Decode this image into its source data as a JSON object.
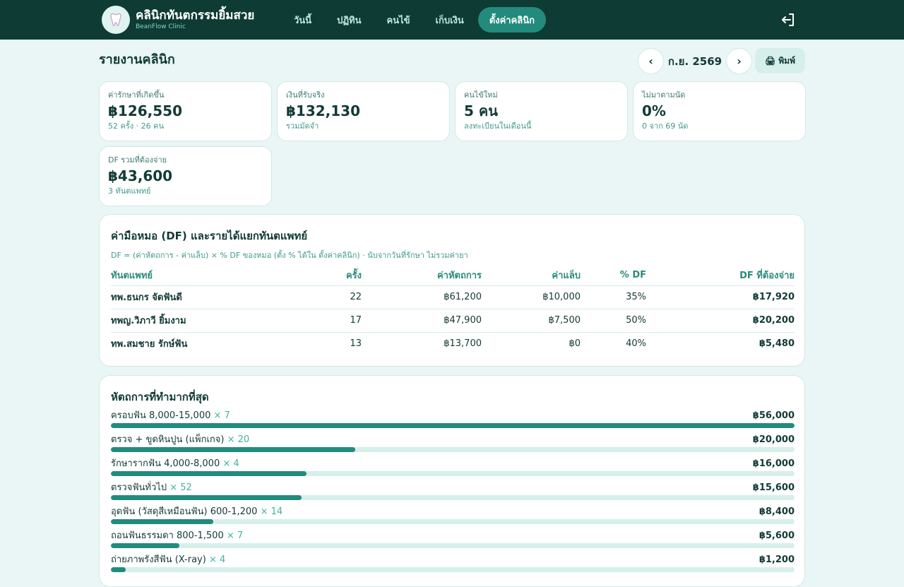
{
  "header": {
    "clinic_name": "คลินิกทันตกรรมยิ้มสวย",
    "clinic_sub": "BeanFlow Clinic",
    "nav": [
      {
        "label": "วันนี้",
        "active": false
      },
      {
        "label": "ปฏิทิน",
        "active": false
      },
      {
        "label": "คนไข้",
        "active": false
      },
      {
        "label": "เก็บเงิน",
        "active": false
      },
      {
        "label": "ตั้งค่าคลินิก",
        "active": true
      }
    ],
    "logout_icon": "logout-icon"
  },
  "report": {
    "title": "รายงานคลินิก",
    "month": "ก.ย. 2569",
    "prev": "‹",
    "next": "›",
    "print_label": "พิมพ์",
    "print_icon": "🖨"
  },
  "stats": [
    {
      "label": "ค่ารักษาที่เกิดขึ้น",
      "value": "฿126,550",
      "sub": "52 ครั้ง · 26 คน"
    },
    {
      "label": "เงินที่รับจริง",
      "value": "฿132,130",
      "sub": "รวมมัดจำ"
    },
    {
      "label": "คนไข้ใหม่",
      "value": "5 คน",
      "sub": "ลงทะเบียนในเดือนนี้"
    },
    {
      "label": "ไม่มาตามนัด",
      "value": "0%",
      "sub": "0 จาก 69 นัด"
    },
    {
      "label": "DF รวมที่ต้องจ่าย",
      "value": "฿43,600",
      "sub": "3 ทันตแพทย์"
    }
  ],
  "df_section": {
    "title": "ค่ามือหมอ (DF) และรายได้แยกทันตแพทย์",
    "note": "DF = (ค่าหัตถการ - ค่าแล็บ) × % DF ของหมอ (ตั้ง % ได้ใน ตั้งค่าคลินิก) · นับจากวันที่รักษา ไม่รวมค่ายา",
    "columns": [
      "ทันตแพทย์",
      "ครั้ง",
      "ค่าหัตถการ",
      "ค่าแล็บ",
      "% DF",
      "DF ที่ต้องจ่าย"
    ],
    "rows": [
      [
        "ทพ.ธนกร จัดฟันดี",
        "22",
        "฿61,200",
        "฿10,000",
        "35%",
        "฿17,920"
      ],
      [
        "ทพญ.วิภาวี ยิ้มงาม",
        "17",
        "฿47,900",
        "฿7,500",
        "50%",
        "฿20,200"
      ],
      [
        "ทพ.สมชาย รักษ์ฟัน",
        "13",
        "฿13,700",
        "฿0",
        "40%",
        "฿5,480"
      ]
    ]
  },
  "procedures": {
    "title": "หัตถการที่ทำมากที่สุด",
    "items": [
      {
        "name": "ครอบฟัน 8,000-15,000",
        "count": "× 7",
        "amount": "฿56,000",
        "value": 56000
      },
      {
        "name": "ตรวจ + ขูดหินปูน (แพ็กเกจ)",
        "count": "× 20",
        "amount": "฿20,000",
        "value": 20000
      },
      {
        "name": "รักษารากฟัน 4,000-8,000",
        "count": "× 4",
        "amount": "฿16,000",
        "value": 16000
      },
      {
        "name": "ตรวจฟันทั่วไป",
        "count": "× 52",
        "amount": "฿15,600",
        "value": 15600
      },
      {
        "name": "อุดฟัน (วัสดุสีเหมือนฟัน) 600-1,200",
        "count": "× 14",
        "amount": "฿8,400",
        "value": 8400
      },
      {
        "name": "ถอนฟันธรรมดา 800-1,500",
        "count": "× 7",
        "amount": "฿5,600",
        "value": 5600
      },
      {
        "name": "ถ่ายภาพรังสีฟัน (X-ray)",
        "count": "× 4",
        "amount": "฿1,200",
        "value": 1200
      }
    ]
  },
  "colors": {
    "topbar": "#0e3b33",
    "accent": "#238b7d",
    "background": "#eaf6f5"
  }
}
